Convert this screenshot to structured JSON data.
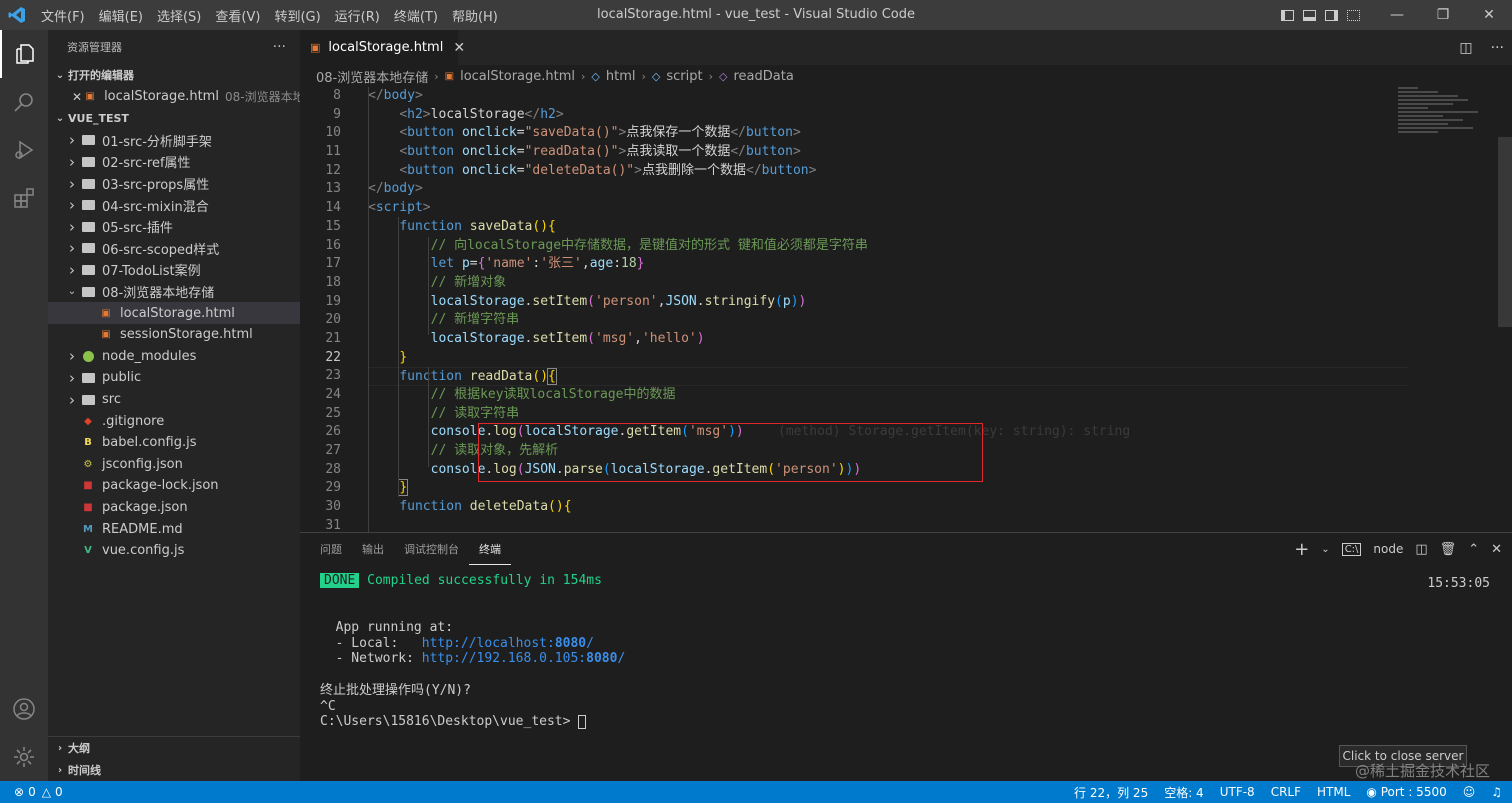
{
  "window": {
    "title": "localStorage.html - vue_test - Visual Studio Code",
    "menu": [
      "文件(F)",
      "编辑(E)",
      "选择(S)",
      "查看(V)",
      "转到(G)",
      "运行(R)",
      "终端(T)",
      "帮助(H)"
    ]
  },
  "sidebar": {
    "header": "资源管理器",
    "open_editors_title": "打开的编辑器",
    "open_editor": {
      "name": "localStorage.html",
      "desc": "08-浏览器本地..."
    },
    "project_title": "VUE_TEST",
    "tree": [
      {
        "label": "01-src-分析脚手架",
        "type": "folder",
        "depth": 1
      },
      {
        "label": "02-src-ref属性",
        "type": "folder",
        "depth": 1
      },
      {
        "label": "03-src-props属性",
        "type": "folder",
        "depth": 1
      },
      {
        "label": "04-src-mixin混合",
        "type": "folder",
        "depth": 1
      },
      {
        "label": "05-src-插件",
        "type": "folder",
        "depth": 1
      },
      {
        "label": "06-src-scoped样式",
        "type": "folder",
        "depth": 1
      },
      {
        "label": "07-TodoList案例",
        "type": "folder",
        "depth": 1
      },
      {
        "label": "08-浏览器本地存储",
        "type": "folder-open",
        "depth": 1
      },
      {
        "label": "localStorage.html",
        "type": "html",
        "depth": 2,
        "selected": true
      },
      {
        "label": "sessionStorage.html",
        "type": "html",
        "depth": 2
      },
      {
        "label": "node_modules",
        "type": "folder",
        "depth": 1
      },
      {
        "label": "public",
        "type": "folder",
        "depth": 1
      },
      {
        "label": "src",
        "type": "folder",
        "depth": 1
      },
      {
        "label": ".gitignore",
        "type": "git",
        "depth": 1
      },
      {
        "label": "babel.config.js",
        "type": "babel",
        "depth": 1
      },
      {
        "label": "jsconfig.json",
        "type": "json",
        "depth": 1
      },
      {
        "label": "package-lock.json",
        "type": "npm",
        "depth": 1
      },
      {
        "label": "package.json",
        "type": "npm",
        "depth": 1
      },
      {
        "label": "README.md",
        "type": "md",
        "depth": 1
      },
      {
        "label": "vue.config.js",
        "type": "vue",
        "depth": 1
      }
    ],
    "outline_title": "大纲",
    "timeline_title": "时间线"
  },
  "editor": {
    "tab": "localStorage.html",
    "breadcrumb": [
      "08-浏览器本地存储",
      "localStorage.html",
      "html",
      "script",
      "readData"
    ],
    "current_line": 22,
    "ghost_hint": "(method) Storage.getItem(key: string): string",
    "line_numbers": [
      "8",
      "9",
      "10",
      "11",
      "12",
      "13",
      "14",
      "15",
      "16",
      "17",
      "18",
      "19",
      "20",
      "21",
      "22",
      "23",
      "24",
      "25",
      "26",
      "27",
      "28",
      "29",
      "30",
      "31"
    ]
  },
  "panel": {
    "tabs": [
      "问题",
      "输出",
      "调试控制台",
      "终端"
    ],
    "active_tab": "终端",
    "shell": "node",
    "time": "15:53:05",
    "done_badge": "DONE",
    "compiled": "Compiled successfully in 154ms",
    "running": "App running at:",
    "local_label": "- Local:   ",
    "local_url": "http://localhost:",
    "local_port": "8080",
    "network_label": "- Network: ",
    "network_url": "http://192.168.0.105:",
    "network_port": "8080",
    "prompt_question": "终止批处理操作吗(Y/N)?",
    "ctrl_c": "^C",
    "prompt": "C:\\Users\\15816\\Desktop\\vue_test>",
    "toast": "Click to close server",
    "watermark": "@稀土掘金技术社区"
  },
  "status": {
    "errors": "0",
    "warnings": "0",
    "position": "行 22，列 25",
    "spaces": "空格: 4",
    "encoding": "UTF-8",
    "eol": "CRLF",
    "language": "HTML",
    "port": "Port : 5500"
  }
}
